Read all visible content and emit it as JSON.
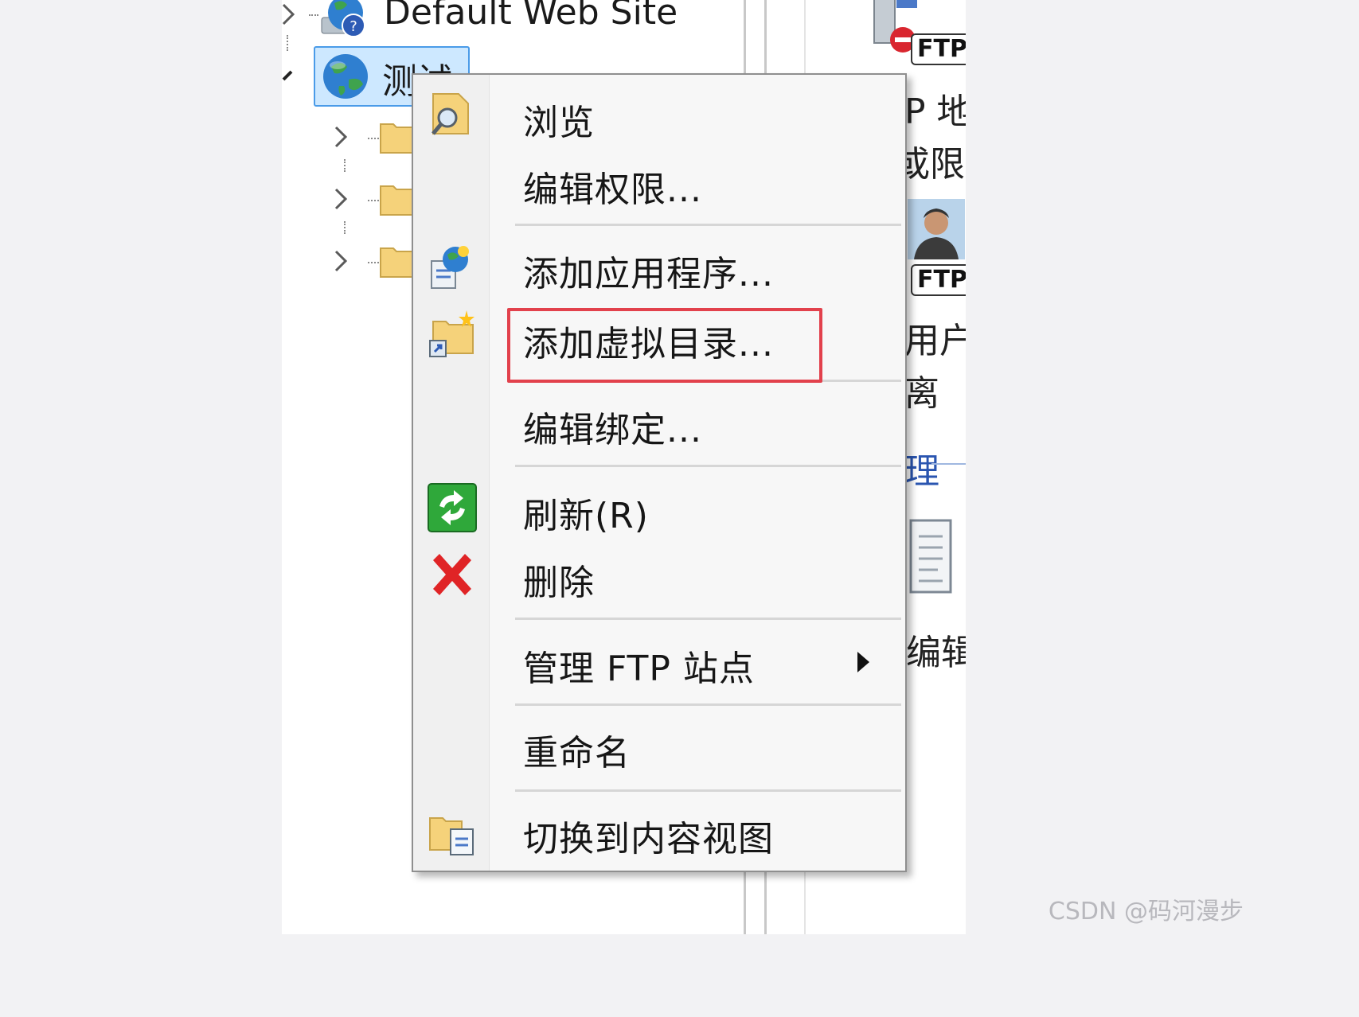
{
  "tree": {
    "root_site": "Default Web Site",
    "selected_site": "测试"
  },
  "right_pane": {
    "ftp_badge": "FTP",
    "fragments": [
      "P 地",
      "或限制",
      "用户",
      "离",
      "理",
      "编辑"
    ]
  },
  "context_menu": {
    "items": [
      {
        "label": "浏览",
        "icon": "folder-search-icon"
      },
      {
        "label": "编辑权限...",
        "icon": ""
      },
      {
        "label": "添加应用程序...",
        "icon": "add-application-icon"
      },
      {
        "label": "添加虚拟目录...",
        "icon": "add-virtual-directory-icon"
      },
      {
        "label": "编辑绑定...",
        "icon": ""
      },
      {
        "label": "刷新(R)",
        "icon": "refresh-icon"
      },
      {
        "label": "删除",
        "icon": "delete-icon"
      },
      {
        "label": "管理 FTP 站点",
        "icon": "",
        "has_submenu": true
      },
      {
        "label": "重命名",
        "icon": ""
      },
      {
        "label": "切换到内容视图",
        "icon": "content-view-icon"
      }
    ],
    "highlighted_item": "添加虚拟目录..."
  },
  "colors": {
    "highlight_border": "#e2414c",
    "selection_background": "#cde8ff",
    "selection_border": "#4a9be8",
    "menu_background": "#f7f7f7"
  },
  "watermark": "CSDN @码河漫步"
}
